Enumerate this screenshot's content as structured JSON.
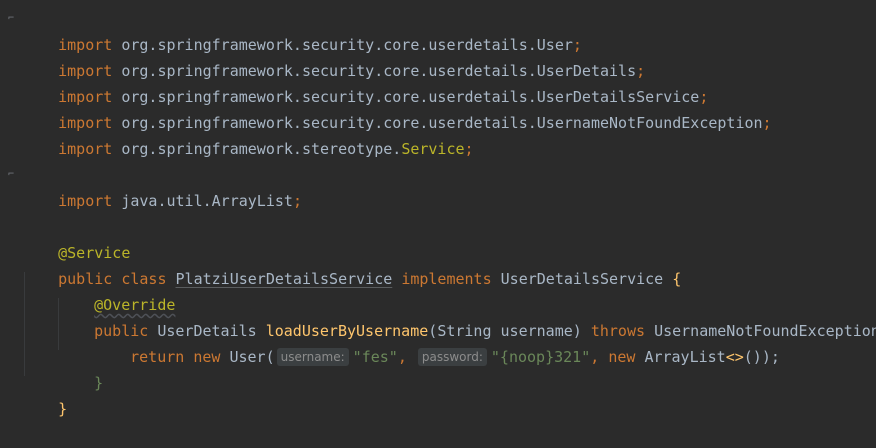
{
  "colors": {
    "background": "#2b2b2b",
    "keyword": "#cc7832",
    "default_text": "#a9b7c6",
    "annotation": "#bbb529",
    "method": "#ffc66d",
    "string": "#6a8759",
    "hint_bg": "#3b3f41",
    "hint_text": "#8c8c8c"
  },
  "code": {
    "kw_import": "import",
    "kw_public": "public",
    "kw_class": "class",
    "kw_implements": "implements",
    "kw_throws": "throws",
    "kw_return": "return",
    "kw_new": "new",
    "semicolon": ";",
    "imports": [
      {
        "pkg": "org.springframework.security.core.userdetails.",
        "name": "User"
      },
      {
        "pkg": "org.springframework.security.core.userdetails.",
        "name": "UserDetails"
      },
      {
        "pkg": "org.springframework.security.core.userdetails.",
        "name": "UserDetailsService"
      },
      {
        "pkg": "org.springframework.security.core.userdetails.",
        "name": "UsernameNotFoundException"
      },
      {
        "pkg": "org.springframework.stereotype.",
        "name": "Service"
      }
    ],
    "util_import": {
      "pkg": "java.util.",
      "name": "ArrayList"
    },
    "class_annotation": "@Service",
    "class_name": "PlatziUserDetailsService",
    "interface_name": "UserDetailsService",
    "open_brace": "{",
    "close_brace": "}",
    "method_annotation": "@Override",
    "return_type": "UserDetails",
    "method_name": "loadUserByUsername",
    "param_open": "(",
    "param_type": "String",
    "param_name": "username",
    "param_close": ")",
    "exception": "UsernameNotFoundException",
    "ctor_class": "User",
    "hint_username": "username:",
    "arg_username": "\"fes\"",
    "comma": ",",
    "hint_password": "password:",
    "arg_password_noop": "\"{noop}",
    "arg_password_rest": "321\"",
    "list_class": "ArrayList",
    "diamond": "<>",
    "call_end": "());"
  }
}
